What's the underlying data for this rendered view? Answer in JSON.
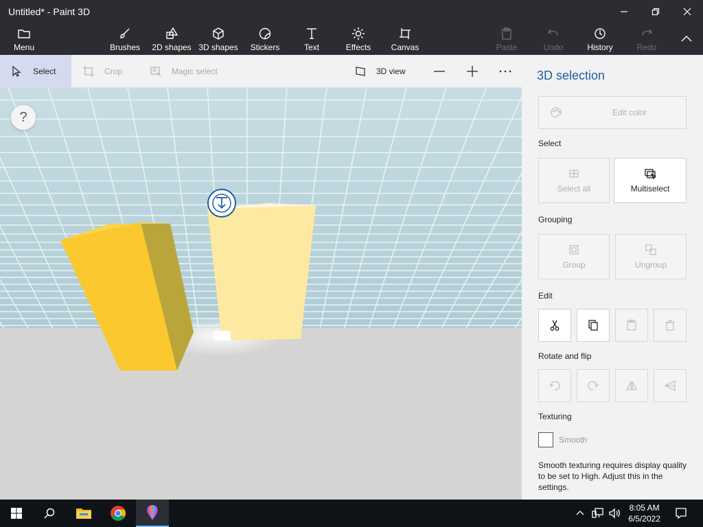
{
  "window": {
    "title": "Untitled* - Paint 3D"
  },
  "ribbon": {
    "menu": "Menu",
    "brushes": "Brushes",
    "shapes2d": "2D shapes",
    "shapes3d": "3D shapes",
    "stickers": "Stickers",
    "text": "Text",
    "effects": "Effects",
    "canvas": "Canvas",
    "paste": "Paste",
    "undo": "Undo",
    "history": "History",
    "redo": "Redo"
  },
  "toolbar": {
    "select": "Select",
    "crop": "Crop",
    "magic_select": "Magic select",
    "view3d": "3D view"
  },
  "canvas": {
    "help": "?"
  },
  "panel": {
    "title": "3D selection",
    "edit_color": "Edit color",
    "select_label": "Select",
    "select_all": "Select all",
    "multiselect": "Multiselect",
    "grouping_label": "Grouping",
    "group": "Group",
    "ungroup": "Ungroup",
    "edit_label": "Edit",
    "rotate_label": "Rotate and flip",
    "texturing_label": "Texturing",
    "smooth": "Smooth",
    "note": "Smooth texturing requires display quality to be set to High. Adjust this in the settings."
  },
  "taskbar": {
    "time": "8:05 AM",
    "date": "6/5/2022"
  },
  "colors": {
    "ribbon_bg": "#2b2d32",
    "accent": "#1f5fa5",
    "active_tool": "#d5daf0",
    "cube_front": "#fbc82f",
    "cube_side": "#b8a53a",
    "cube_selected": "#fde9a0",
    "grid_sky": "#b8d3dc"
  }
}
